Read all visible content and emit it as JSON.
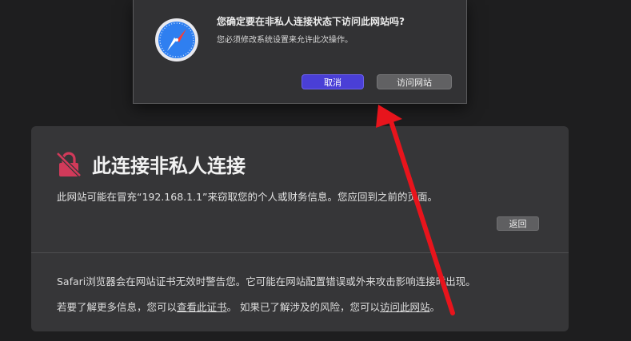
{
  "alert": {
    "title": "您确定要在非私人连接状态下访问此网站吗?",
    "message": "您必须修改系统设置来允许此次操作。",
    "cancel_label": "取消",
    "visit_label": "访问网站"
  },
  "panel": {
    "heading": "此连接非私人连接",
    "description": "此网站可能在冒充“192.168.1.1”来窃取您的个人或财务信息。您应回到之前的页面。",
    "back_label": "返回",
    "info_line1": "Safari浏览器会在网站证书无效时警告您。它可能在网站配置错误或外来攻击影响连接时出现。",
    "info_line2_prefix": "若要了解更多信息，您可以",
    "view_certificate_link": "查看此证书",
    "info_line2_middle": "。 如果已了解涉及的风险，您可以",
    "visit_site_link": "访问此网站",
    "info_line2_suffix": "。"
  },
  "colors": {
    "background": "#1e1e1f",
    "alert_bg": "#323234",
    "panel_bg": "#363638",
    "accent_button": "#4a3fd6",
    "lock_icon": "#d13a5a",
    "annotation_arrow": "#e8141c"
  },
  "icons": {
    "app": "safari-compass-icon",
    "warning": "broken-lock-icon",
    "annotation": "red-arrow-annotation"
  }
}
